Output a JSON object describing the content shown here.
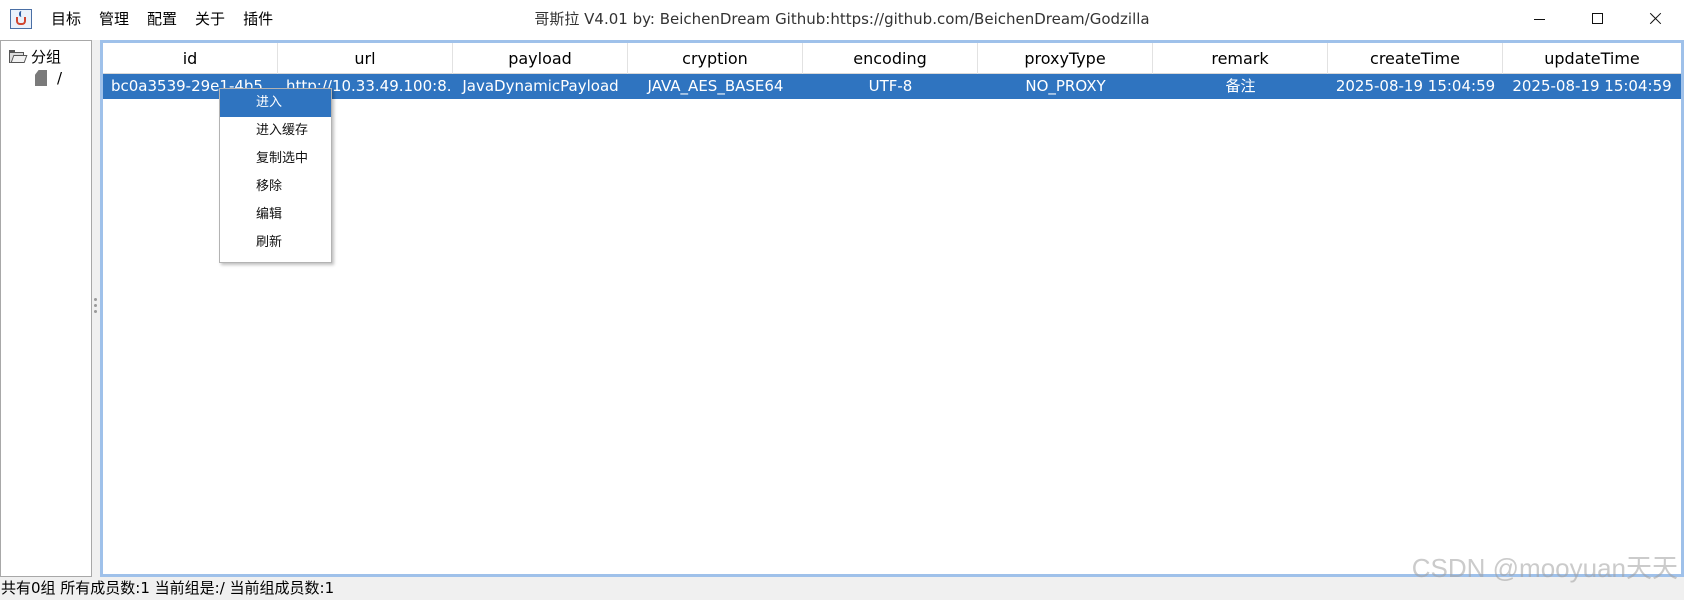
{
  "window": {
    "title": "哥斯拉   V4.01 by: BeichenDream Github:https://github.com/BeichenDream/Godzilla",
    "app_icon": "java-cup-icon"
  },
  "menu": [
    "目标",
    "管理",
    "配置",
    "关于",
    "插件"
  ],
  "tree": {
    "root_label": "分组",
    "root_icon": "folder-open-icon",
    "child_label": "/",
    "child_icon": "file-icon"
  },
  "table": {
    "columns": [
      "id",
      "url",
      "payload",
      "cryption",
      "encoding",
      "proxyType",
      "remark",
      "createTime",
      "updateTime"
    ],
    "rows": [
      [
        "bc0a3539-29e1-4b5...",
        "http://10.33.49.100:8...",
        "JavaDynamicPayload",
        "JAVA_AES_BASE64",
        "UTF-8",
        "NO_PROXY",
        "备注",
        "2025-08-19 15:04:59",
        "2025-08-19 15:04:59"
      ]
    ],
    "selected_row": 0
  },
  "context_menu": {
    "items": [
      "进入",
      "进入缓存",
      "复制选中",
      "移除",
      "编辑",
      "刷新"
    ],
    "highlighted": 0
  },
  "status": "共有0组 所有成员数:1 当前组是:/ 当前组成员数:1",
  "watermark": "CSDN @mooyuan天天",
  "colors": {
    "selection": "#2f74c0",
    "table_border": "#9fc1ea"
  }
}
